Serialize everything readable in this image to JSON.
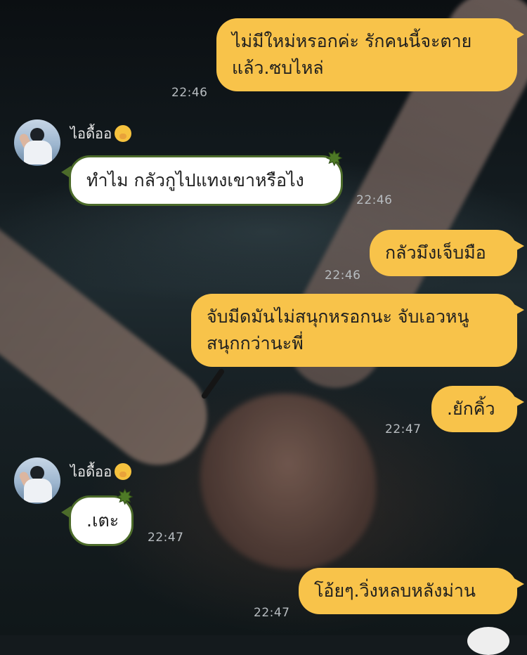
{
  "chat": {
    "contact": {
      "name": "ไอดื้ออ",
      "status_emoji": "🤭"
    },
    "messages": [
      {
        "from": "me",
        "lines": [
          "ไม่มีใหม่หรอกค่ะ รักคนนี้จะตาย",
          "แล้ว.ซบไหล่"
        ],
        "time": "22:46"
      },
      {
        "from": "contact",
        "text": "ทำไม กลัวกูไปแทงเขาหรือไง",
        "time": "22:46"
      },
      {
        "from": "me",
        "text": "กลัวมึงเจ็บมือ",
        "time": "22:46"
      },
      {
        "from": "me",
        "lines": [
          "จับมีดมันไม่สนุกหรอกนะ จับเอวหนู",
          "สนุกกว่านะพี่"
        ]
      },
      {
        "from": "me",
        "text": ".ยักคิ้ว",
        "time": "22:47"
      },
      {
        "from": "contact",
        "text": ".เตะ",
        "time": "22:47"
      },
      {
        "from": "me",
        "text": "โอ้ยๆ.วิ่งหลบหลังม่าน",
        "time": "22:47"
      }
    ]
  },
  "colors": {
    "my_bubble": "#f8c34a",
    "their_bubble": "#ffffff",
    "their_border": "#4c6b2a",
    "timestamp": "#b7bcc0"
  },
  "icons": {
    "bubble_decoration": "star-icon",
    "avatar": "avatar-photo"
  }
}
